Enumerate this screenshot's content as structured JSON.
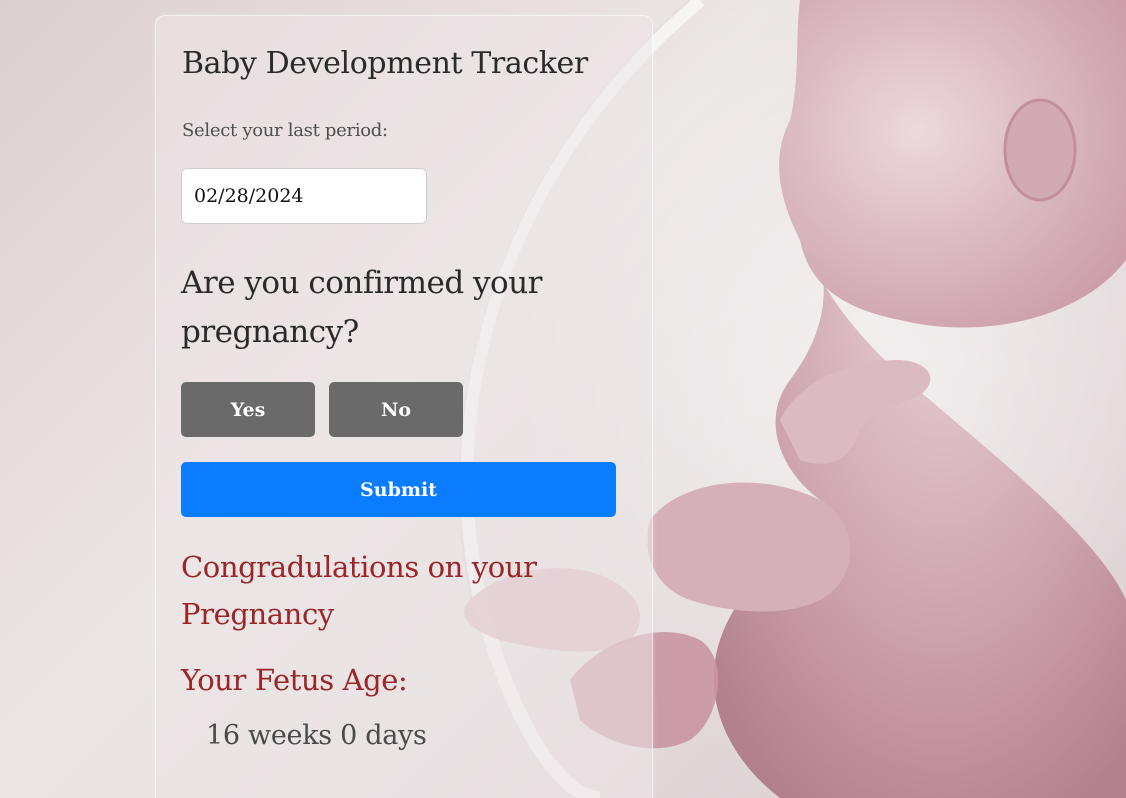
{
  "tracker": {
    "title": "Baby Development Tracker",
    "period_label": "Select your last period:",
    "period_value": "02/28/2024",
    "question": "Are you confirmed your pregnancy?",
    "yes_label": "Yes",
    "no_label": "No",
    "submit_label": "Submit"
  },
  "result": {
    "congrats_message": "Congradulations on your Pregnancy",
    "age_label": "Your Fetus Age:",
    "age_value": "16 weeks 0 days"
  },
  "colors": {
    "submit_button": "#0a7cff",
    "choice_button": "#6a6a6a",
    "result_text": "#9b2527",
    "background": "#e9e3e4"
  }
}
